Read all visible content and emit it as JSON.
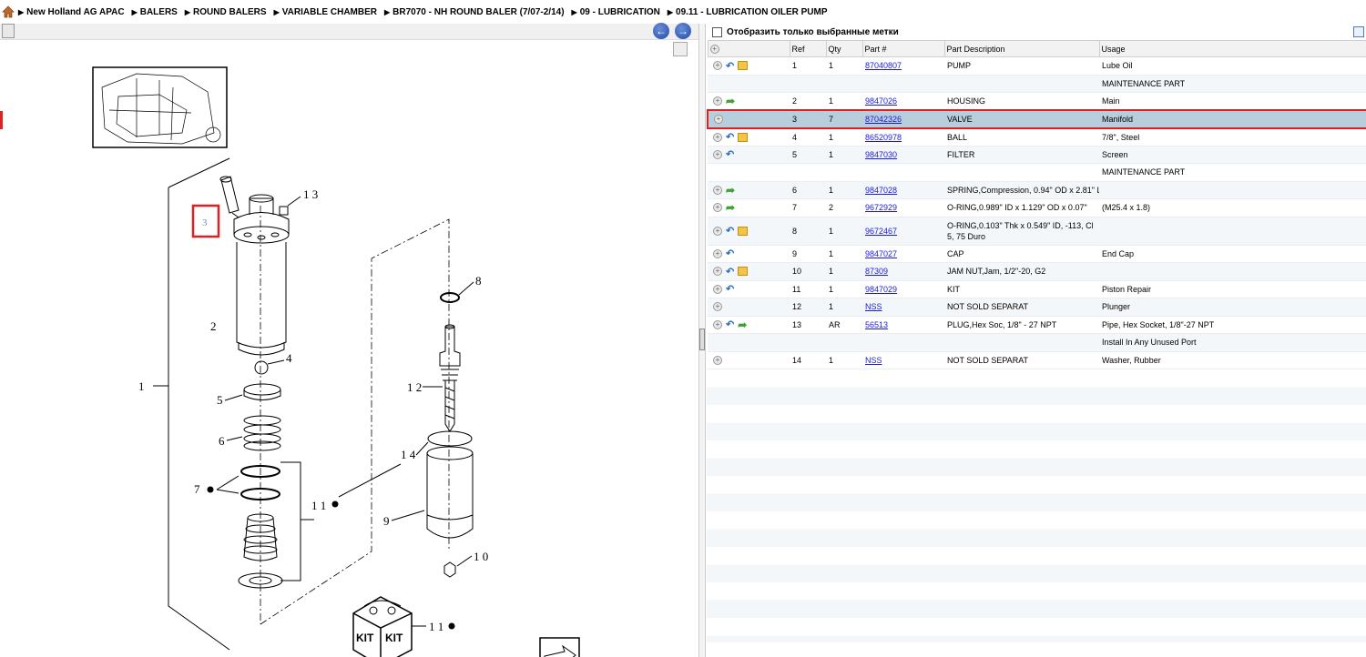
{
  "breadcrumb": [
    "New Holland AG APAC",
    "BALERS",
    "ROUND BALERS",
    "VARIABLE CHAMBER",
    "BR7070 - NH ROUND BALER (7/07-2/14)",
    "09 - LUBRICATION",
    "09.11 - LUBRICATION OILER PUMP"
  ],
  "filter": {
    "label": "Отобразить только выбранные метки"
  },
  "columns": {
    "ref": "Ref",
    "qty": "Qty",
    "part": "Part #",
    "desc": "Part Description",
    "usage": "Usage"
  },
  "rows": [
    {
      "ref": "1",
      "qty": "1",
      "part": "87040807",
      "desc": "PUMP",
      "usage": "Lube Oil",
      "icons": [
        "circle",
        "back",
        "box"
      ]
    },
    {
      "ref": "",
      "qty": "",
      "part": "",
      "desc": "",
      "usage": "MAINTENANCE PART",
      "icons": []
    },
    {
      "ref": "2",
      "qty": "1",
      "part": "9847026",
      "desc": "HOUSING",
      "usage": "Main",
      "icons": [
        "circle",
        "fwd"
      ]
    },
    {
      "ref": "3",
      "qty": "7",
      "part": "87042326",
      "desc": "VALVE",
      "usage": "Manifold",
      "icons": [
        "circle"
      ],
      "selected": true
    },
    {
      "ref": "4",
      "qty": "1",
      "part": "86520978",
      "desc": "BALL",
      "usage": "7/8\", Steel",
      "icons": [
        "circle",
        "back",
        "box"
      ]
    },
    {
      "ref": "5",
      "qty": "1",
      "part": "9847030",
      "desc": "FILTER",
      "usage": "Screen",
      "icons": [
        "circle",
        "back"
      ]
    },
    {
      "ref": "",
      "qty": "",
      "part": "",
      "desc": "",
      "usage": "MAINTENANCE PART",
      "icons": []
    },
    {
      "ref": "6",
      "qty": "1",
      "part": "9847028",
      "desc": "SPRING,Compression, 0.94\" OD x 2.81\" L",
      "usage": "",
      "icons": [
        "circle",
        "fwd"
      ]
    },
    {
      "ref": "7",
      "qty": "2",
      "part": "9672929",
      "desc": "O-RING,0.989\" ID x 1.129\" OD x 0.07\"",
      "usage": "(M25.4 x 1.8)",
      "icons": [
        "circle",
        "fwd"
      ]
    },
    {
      "ref": "8",
      "qty": "1",
      "part": "9672467",
      "desc": "O-RING,0.103\" Thk x 0.549\" ID, -113, Cl 5, 75 Duro",
      "usage": "",
      "icons": [
        "circle",
        "back",
        "box"
      ],
      "tall": true
    },
    {
      "ref": "9",
      "qty": "1",
      "part": "9847027",
      "desc": "CAP",
      "usage": "End Cap",
      "icons": [
        "circle",
        "back"
      ]
    },
    {
      "ref": "10",
      "qty": "1",
      "part": "87309",
      "desc": "JAM NUT,Jam, 1/2\"-20, G2",
      "usage": "",
      "icons": [
        "circle",
        "back",
        "box"
      ]
    },
    {
      "ref": "11",
      "qty": "1",
      "part": "9847029",
      "desc": "KIT",
      "usage": "Piston Repair",
      "icons": [
        "circle",
        "back"
      ]
    },
    {
      "ref": "12",
      "qty": "1",
      "part": "NSS",
      "desc": "NOT SOLD SEPARAT",
      "usage": "Plunger",
      "icons": [
        "circle"
      ]
    },
    {
      "ref": "13",
      "qty": "AR",
      "part": "56513",
      "desc": "PLUG,Hex Soc, 1/8\" - 27 NPT",
      "usage": "Pipe, Hex Socket, 1/8\"-27 NPT",
      "icons": [
        "circle",
        "back",
        "fwd"
      ]
    },
    {
      "ref": "",
      "qty": "",
      "part": "",
      "desc": "",
      "usage": "Install In Any Unused Port",
      "icons": []
    },
    {
      "ref": "14",
      "qty": "1",
      "part": "NSS",
      "desc": "NOT SOLD SEPARAT",
      "usage": "Washer, Rubber",
      "icons": [
        "circle"
      ]
    }
  ],
  "diagram": {
    "callouts": [
      "1",
      "2",
      "3",
      "4",
      "5",
      "6",
      "7",
      "8",
      "9",
      "10",
      "11",
      "12",
      "13",
      "14",
      "11",
      "11"
    ],
    "kit_label": "KIT"
  }
}
